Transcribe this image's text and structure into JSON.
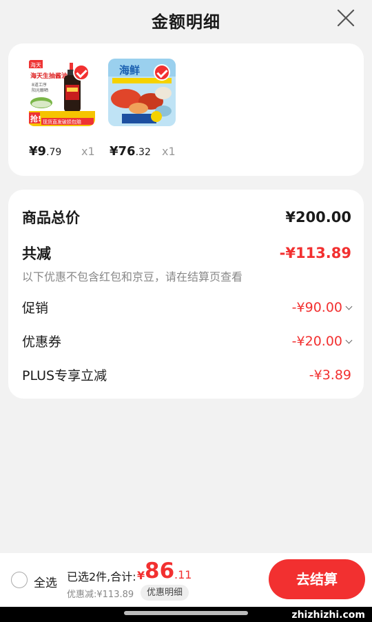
{
  "header": {
    "title": "金额明细"
  },
  "products": [
    {
      "image_text_1": "海天生抽酱油",
      "image_text_2": "8道工序 阳光酿晒",
      "image_text_3": "抢!",
      "image_text_4": "现货直发破损包赔",
      "price_int": "9",
      "price_dec": ".79",
      "qty": "x1"
    },
    {
      "image_text_1": "海鲜",
      "price_int": "76",
      "price_dec": ".32",
      "qty": "x1"
    }
  ],
  "summary": {
    "total_label": "商品总价",
    "total_value": "¥200.00",
    "reduce_label": "共减",
    "reduce_value": "-¥113.89",
    "note": "以下优惠不包含红包和京豆，请在结算页查看",
    "rows": [
      {
        "label": "促销",
        "value": "-¥90.00"
      },
      {
        "label": "优惠券",
        "value": "-¥20.00"
      },
      {
        "label": "PLUS专享立减",
        "value": "-¥3.89"
      }
    ]
  },
  "bottom": {
    "select_all": "全选",
    "selected_text": "已选2件,合计:",
    "currency": "¥",
    "total_int": "86",
    "total_dec": ".11",
    "discount_text": "优惠减:¥113.89",
    "detail_button": "优惠明细",
    "checkout_label": "去结算"
  },
  "watermark": "zhizhizhi.com",
  "colors": {
    "accent": "#f23030",
    "background": "#f2f2f2"
  }
}
